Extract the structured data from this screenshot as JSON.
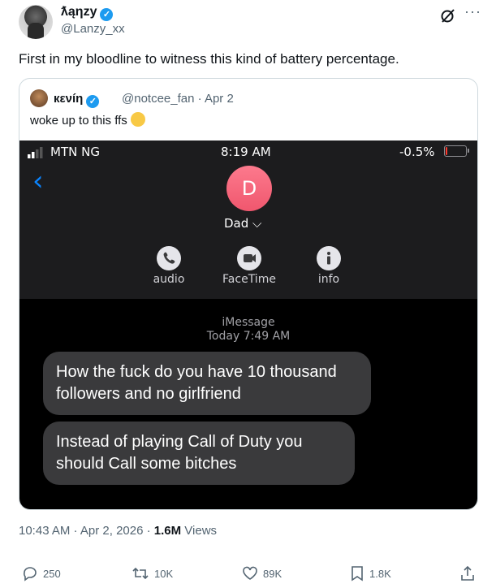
{
  "author": {
    "display_name": "ƛąηzy",
    "handle": "@Lanzy_xx",
    "verified": true
  },
  "tweet": {
    "text": "First in my bloodline to witness this kind of battery percentage."
  },
  "quote": {
    "display_name": "кενíη",
    "handle_date": "@notcee_fan · Apr 2",
    "text": "woke up to this ffs",
    "screenshot": {
      "carrier": "MTN NG",
      "time": "8:19 AM",
      "battery_percent_label": "-0.5%",
      "battery_level": 0.02,
      "back_glyph": "‹",
      "contact_initial": "D",
      "contact_name": "Dad ⌵",
      "actions": [
        {
          "label": "audio",
          "icon": "phone-icon"
        },
        {
          "label": "FaceTime",
          "icon": "video-icon"
        },
        {
          "label": "info",
          "icon": "info-icon"
        }
      ],
      "service": "iMessage",
      "timestamp": "Today 7:49 AM",
      "messages": [
        "How the fuck do you have 10 thousand followers and no girlfriend",
        "Instead of playing Call of Duty you should Call some bitches"
      ]
    }
  },
  "meta": {
    "time_date": "10:43 AM · Apr 2, 2026 · ",
    "views_count": "1.6M",
    "views_label": " Views"
  },
  "stats": {
    "replies": "250",
    "reposts": "10K",
    "likes": "89K",
    "bookmarks": "1.8K"
  },
  "colors": {
    "accent": "#1d9bf0",
    "bubble": "#3a3a3c",
    "ios_blue": "#0a84ff",
    "contact": "#f0576e"
  }
}
